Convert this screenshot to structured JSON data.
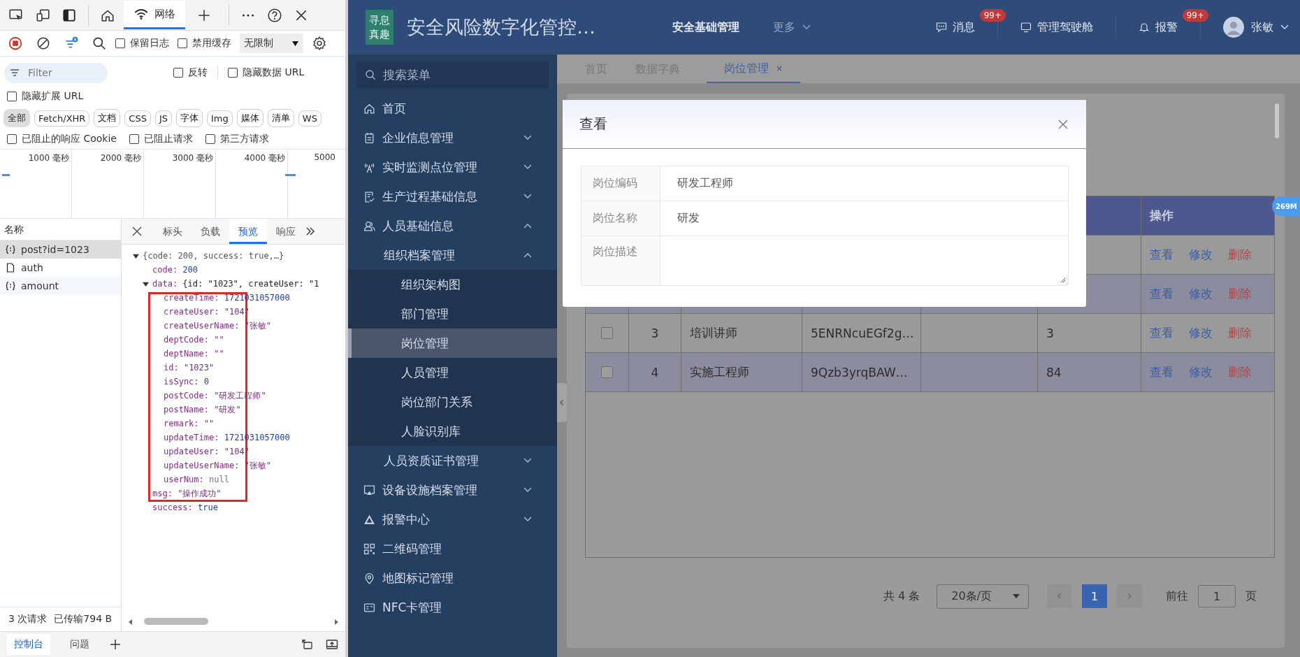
{
  "devtools": {
    "tabs": [
      {
        "label": "网络",
        "selected": true
      }
    ],
    "toolbar": {
      "preserve_log": {
        "label": "保留日志",
        "checked": false
      },
      "disable_cache": {
        "label": "禁用缓存",
        "checked": false
      },
      "throttle": "无限制"
    },
    "filter": {
      "placeholder": "Filter"
    },
    "filter_options": [
      {
        "label": "反转",
        "checked": false
      },
      {
        "label": "隐藏数据 URL",
        "checked": false
      }
    ],
    "hide_extension": {
      "label": "隐藏扩展 URL",
      "checked": false
    },
    "type_chips": [
      {
        "label": "全部",
        "selected": true
      },
      {
        "label": "Fetch/XHR",
        "selected": false
      },
      {
        "label": "文档",
        "selected": false
      },
      {
        "label": "CSS",
        "selected": false
      },
      {
        "label": "JS",
        "selected": false
      },
      {
        "label": "字体",
        "selected": false
      },
      {
        "label": "Img",
        "selected": false
      },
      {
        "label": "媒体",
        "selected": false
      },
      {
        "label": "清单",
        "selected": false
      },
      {
        "label": "WS",
        "selected": false
      }
    ],
    "blocked_options": [
      {
        "label": "已阻止的响应 Cookie",
        "checked": false
      },
      {
        "label": "已阻止请求",
        "checked": false
      },
      {
        "label": "第三方请求",
        "checked": false
      }
    ],
    "timeline": {
      "ticks": [
        "1000 毫秒",
        "2000 毫秒",
        "3000 毫秒",
        "4000 毫秒",
        "5000"
      ]
    },
    "requests": {
      "header": "名称",
      "rows": [
        {
          "name": "post?id=1023",
          "kind": "json",
          "selected": true
        },
        {
          "name": "auth",
          "kind": "doc",
          "selected": false
        },
        {
          "name": "amount",
          "kind": "json",
          "selected": false
        }
      ]
    },
    "detail_tabs": [
      {
        "label": "标头",
        "selected": false
      },
      {
        "label": "负载",
        "selected": false
      },
      {
        "label": "预览",
        "selected": true
      },
      {
        "label": "响应",
        "selected": false
      }
    ],
    "preview": {
      "tree": {
        "summary": "{code: 200, success: true,…}",
        "expanded": true,
        "children": [
          {
            "key": "code:",
            "value": "200",
            "kind": "number"
          },
          {
            "key": "data:",
            "summary": "{id: \"1023\", createUser: \"1",
            "expanded": true,
            "children": [
              {
                "key": "createTime:",
                "value": "1721031057000",
                "kind": "number"
              },
              {
                "key": "createUser:",
                "value": "\"104\"",
                "kind": "string"
              },
              {
                "key": "createUserName:",
                "value": "\"张敏\"",
                "kind": "string"
              },
              {
                "key": "deptCode:",
                "value": "\"\"",
                "kind": "string"
              },
              {
                "key": "deptName:",
                "value": "\"\"",
                "kind": "string"
              },
              {
                "key": "id:",
                "value": "\"1023\"",
                "kind": "string"
              },
              {
                "key": "isSync:",
                "value": "0",
                "kind": "number"
              },
              {
                "key": "postCode:",
                "value": "\"研发工程师\"",
                "kind": "string"
              },
              {
                "key": "postName:",
                "value": "\"研发\"",
                "kind": "string"
              },
              {
                "key": "remark:",
                "value": "\"\"",
                "kind": "string"
              },
              {
                "key": "updateTime:",
                "value": "1721031057000",
                "kind": "number"
              },
              {
                "key": "updateUser:",
                "value": "\"104\"",
                "kind": "string"
              },
              {
                "key": "updateUserName:",
                "value": "\"张敏\"",
                "kind": "string"
              },
              {
                "key": "userNum:",
                "value": "null",
                "kind": "null"
              }
            ]
          },
          {
            "key": "msg:",
            "value": "\"操作成功\"",
            "kind": "string"
          },
          {
            "key": "success:",
            "value": "true",
            "kind": "boolean"
          }
        ]
      }
    },
    "status": {
      "requests": "3 次请求",
      "transferred": "已传输794 B"
    },
    "drawer_tabs": [
      {
        "label": "控制台",
        "selected": true
      },
      {
        "label": "问题",
        "selected": false
      }
    ]
  },
  "app": {
    "logo": "寻息真趣",
    "title": "安全风险数字化管控…",
    "nav": [
      {
        "label": "安全基础管理",
        "selected": true,
        "kind": "link"
      },
      {
        "label": "更多",
        "selected": false,
        "kind": "dropdown"
      }
    ],
    "messages": {
      "label": "消息",
      "badge": "99+"
    },
    "cockpit": {
      "label": "管理驾驶舱"
    },
    "alarms": {
      "label": "报警",
      "badge": "99+"
    },
    "user": {
      "name": "张敏"
    },
    "sidebar": {
      "search_placeholder": "搜索菜单",
      "items": [
        {
          "label": "首页",
          "selected": false
        },
        {
          "label": "企业信息管理",
          "expanded": false,
          "selected": false
        },
        {
          "label": "实时监测点位管理",
          "expanded": false,
          "selected": false
        },
        {
          "label": "生产过程基础信息",
          "expanded": false,
          "selected": false
        },
        {
          "label": "人员基础信息",
          "expanded": true,
          "selected": false,
          "children": [
            {
              "label": "组织档案管理",
              "expanded": true,
              "selected": false,
              "children": [
                {
                  "label": "组织架构图",
                  "selected": false
                },
                {
                  "label": "部门管理",
                  "selected": false
                },
                {
                  "label": "岗位管理",
                  "selected": true
                },
                {
                  "label": "人员管理",
                  "selected": false
                },
                {
                  "label": "岗位部门关系",
                  "selected": false
                },
                {
                  "label": "人脸识别库",
                  "selected": false
                }
              ]
            },
            {
              "label": "人员资质证书管理",
              "expanded": false,
              "selected": false
            }
          ]
        },
        {
          "label": "设备设施档案管理",
          "expanded": false,
          "selected": false
        },
        {
          "label": "报警中心",
          "expanded": false,
          "selected": false
        },
        {
          "label": "二维码管理",
          "selected": false
        },
        {
          "label": "地图标记管理",
          "selected": false
        },
        {
          "label": "NFC卡管理",
          "selected": false
        }
      ]
    },
    "page_tabs": [
      {
        "label": "首页",
        "selected": false,
        "closable": false
      },
      {
        "label": "数据字典",
        "selected": false,
        "closable": false
      },
      {
        "label": "岗位管理",
        "selected": true,
        "closable": true
      }
    ],
    "memory_badge": "269M",
    "table": {
      "action_header": "操作",
      "rows": [
        {
          "actions": [
            {
              "label": "查看",
              "kind": "link"
            },
            {
              "label": "修改",
              "kind": "link"
            },
            {
              "label": "删除",
              "kind": "danger"
            }
          ]
        },
        {
          "actions": [
            {
              "label": "查看",
              "kind": "link"
            },
            {
              "label": "修改",
              "kind": "link"
            },
            {
              "label": "删除",
              "kind": "danger"
            }
          ]
        },
        {
          "checked": false,
          "index": "3",
          "name": "培训讲师",
          "code": "5ENRNcuEGf2g…",
          "column_6": "3",
          "actions": [
            {
              "label": "查看",
              "kind": "link"
            },
            {
              "label": "修改",
              "kind": "link"
            },
            {
              "label": "删除",
              "kind": "danger"
            }
          ]
        },
        {
          "checked": false,
          "index": "4",
          "name": "实施工程师",
          "code": "9Qzb3yrqBAW…",
          "column_6": "84",
          "actions": [
            {
              "label": "查看",
              "kind": "link"
            },
            {
              "label": "修改",
              "kind": "link"
            },
            {
              "label": "删除",
              "kind": "danger"
            }
          ]
        }
      ]
    },
    "pagination": {
      "total": "共 4 条",
      "page_size": "20条/页",
      "pages": [
        {
          "label": "1",
          "selected": true
        }
      ],
      "goto_label": "前往",
      "goto_value": "1",
      "page_unit": "页"
    },
    "dialog": {
      "title": "查看",
      "fields": [
        {
          "label": "岗位编码",
          "value": "研发工程师",
          "kind": "text"
        },
        {
          "label": "岗位名称",
          "value": "研发",
          "kind": "text"
        },
        {
          "label": "岗位描述",
          "kind": "textarea"
        }
      ]
    }
  }
}
